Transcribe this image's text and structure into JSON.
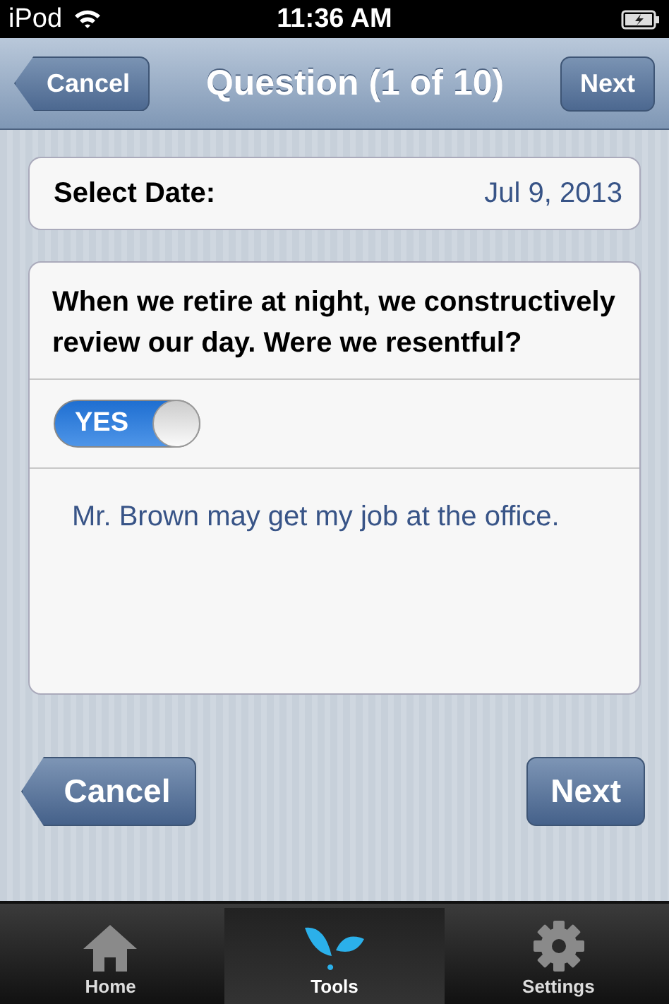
{
  "status_bar": {
    "carrier": "iPod",
    "time": "11:36 AM"
  },
  "nav_bar": {
    "back_button": "Cancel",
    "title": "Question (1 of 10)",
    "next_button": "Next"
  },
  "date_row": {
    "label": "Select Date:",
    "value": "Jul 9, 2013"
  },
  "question": {
    "text": "When we retire at night, we constructively review our day. Were we resentful?",
    "toggle": {
      "label": "YES",
      "on": true
    },
    "answer": "Mr. Brown may get my job at the office."
  },
  "buttons": {
    "cancel": "Cancel",
    "next": "Next"
  },
  "tabs": [
    {
      "label": "Home",
      "selected": false
    },
    {
      "label": "Tools",
      "selected": true
    },
    {
      "label": "Settings",
      "selected": false
    }
  ]
}
